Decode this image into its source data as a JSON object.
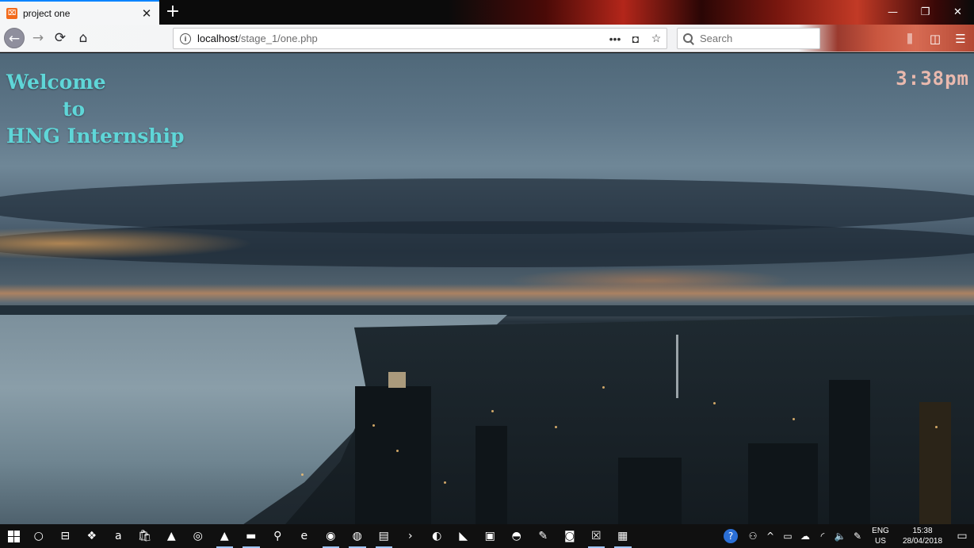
{
  "browser": {
    "tab": {
      "title": "project one",
      "favicon": "xampp-icon",
      "close": "✕"
    },
    "new_tab": "+",
    "window_controls": [
      "—",
      "❐",
      "✕"
    ],
    "nav": {
      "back": "←",
      "forward": "→",
      "reload": "⟳",
      "home": "⌂"
    },
    "url": {
      "host": "localhost",
      "path": "/stage_1/one.php",
      "info": "i",
      "menu": "•••",
      "pocket": "◘",
      "bookmark": "☆"
    },
    "search": {
      "placeholder": "Search"
    },
    "toolbar": {
      "library": "⫼",
      "sidebar": "◫",
      "menu": "☰"
    }
  },
  "page": {
    "welcome": {
      "line1": "Welcome",
      "line2": "to",
      "line3": "HNG Internship"
    },
    "clock": "3:38pm",
    "colors": {
      "welcome_text": "#5fd6d8",
      "clock_text": "#e9b9ae"
    }
  },
  "taskbar": {
    "apps": [
      {
        "name": "cortana-icon",
        "glyph": "○",
        "running": false
      },
      {
        "name": "task-view-icon",
        "glyph": "⊟",
        "running": false
      },
      {
        "name": "dropbox-icon",
        "glyph": "❖",
        "running": false
      },
      {
        "name": "amazon-icon",
        "glyph": "a",
        "running": false
      },
      {
        "name": "store-icon",
        "glyph": "🛍",
        "running": false
      },
      {
        "name": "vlc-icon",
        "glyph": "▲",
        "running": false
      },
      {
        "name": "media-icon",
        "glyph": "◎",
        "running": false
      },
      {
        "name": "vlc-running-icon",
        "glyph": "▲",
        "running": true
      },
      {
        "name": "file-explorer-icon",
        "glyph": "▬",
        "running": true
      },
      {
        "name": "search-tool-icon",
        "glyph": "⚲",
        "running": false
      },
      {
        "name": "edge-icon",
        "glyph": "e",
        "running": false
      },
      {
        "name": "chrome-icon",
        "glyph": "◉",
        "running": true
      },
      {
        "name": "firefox-icon",
        "glyph": "◍",
        "running": true
      },
      {
        "name": "notepad-icon",
        "glyph": "▤",
        "running": true
      },
      {
        "name": "powershell-icon",
        "glyph": "›",
        "running": false
      },
      {
        "name": "xbox-icon",
        "glyph": "◐",
        "running": false
      },
      {
        "name": "visual-studio-icon",
        "glyph": "◣",
        "running": false
      },
      {
        "name": "webstorm-icon",
        "glyph": "▣",
        "running": false
      },
      {
        "name": "android-icon",
        "glyph": "◓",
        "running": false
      },
      {
        "name": "pen-icon",
        "glyph": "✎",
        "running": false
      },
      {
        "name": "github-icon",
        "glyph": "◙",
        "running": false
      },
      {
        "name": "xampp-icon",
        "glyph": "☒",
        "running": true
      },
      {
        "name": "sticky-notes-icon",
        "glyph": "▦",
        "running": true
      }
    ],
    "tray": {
      "icons": [
        "?",
        "⚇",
        "^",
        "▭",
        "☁",
        "◜",
        "🔈",
        "✎"
      ],
      "lang_line1": "ENG",
      "lang_line2": "US",
      "time": "15:38",
      "date": "28/04/2018",
      "notifications": "▭"
    }
  }
}
